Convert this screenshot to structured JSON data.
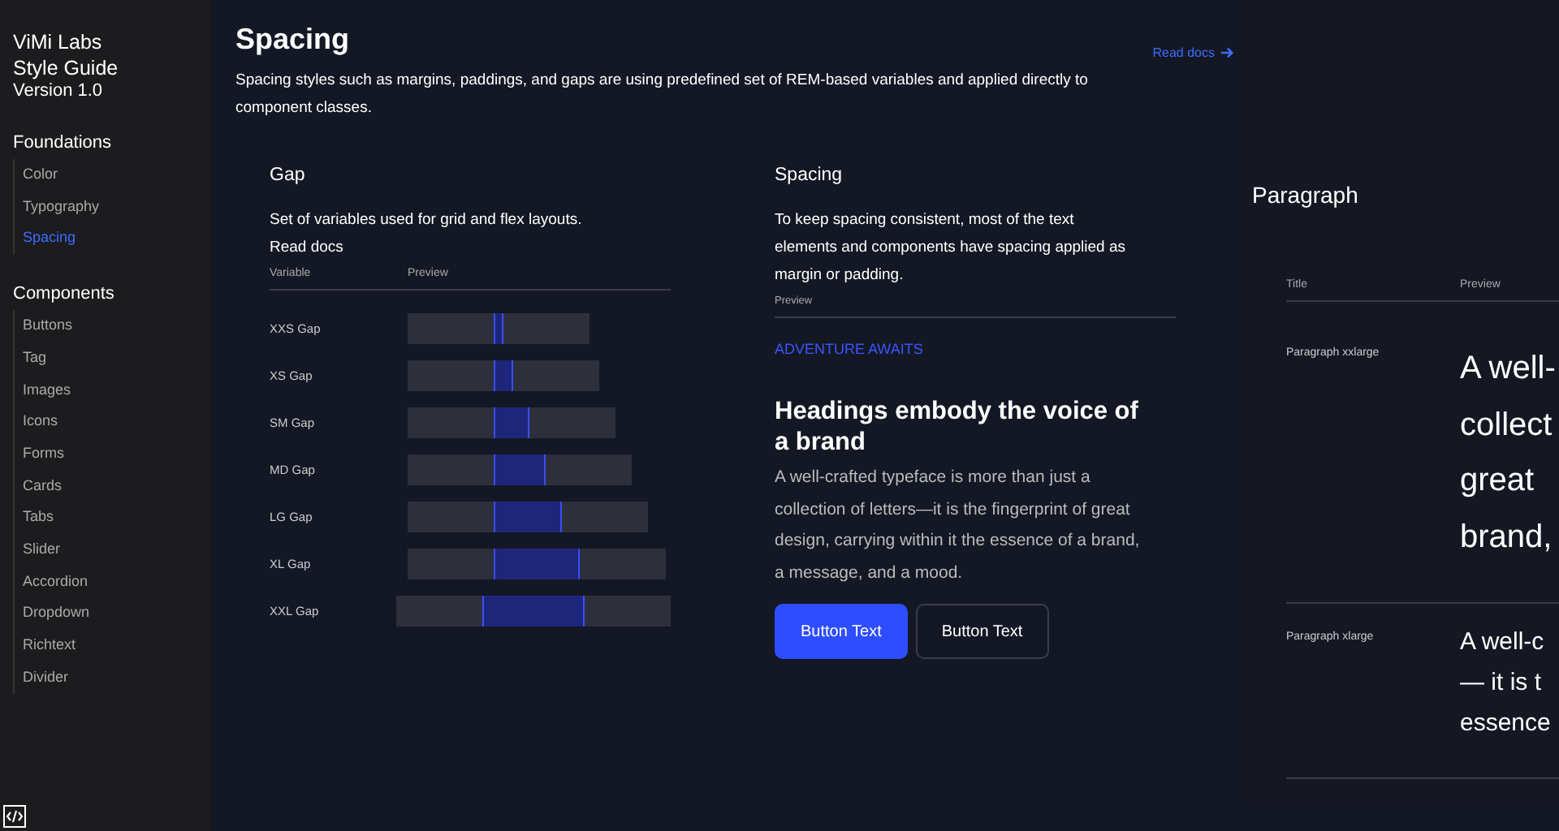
{
  "sidebar": {
    "brand": [
      "ViMi Labs",
      "Style Guide"
    ],
    "version": "Version 1.0",
    "groups": [
      {
        "title": "Foundations",
        "items": [
          {
            "label": "Color",
            "selected": false
          },
          {
            "label": "Typography",
            "selected": false
          },
          {
            "label": "Spacing",
            "selected": true
          }
        ]
      },
      {
        "title": "Components",
        "items": [
          {
            "label": "Buttons",
            "selected": false
          },
          {
            "label": "Tag",
            "selected": false
          },
          {
            "label": "Images",
            "selected": false
          },
          {
            "label": "Icons",
            "selected": false
          },
          {
            "label": "Forms",
            "selected": false
          },
          {
            "label": "Cards",
            "selected": false
          },
          {
            "label": "Tabs",
            "selected": false
          },
          {
            "label": "Slider",
            "selected": false
          },
          {
            "label": "Accordion",
            "selected": false
          },
          {
            "label": "Dropdown",
            "selected": false
          },
          {
            "label": "Richtext",
            "selected": false
          },
          {
            "label": "Divider",
            "selected": false
          }
        ]
      }
    ]
  },
  "header": {
    "title": "Spacing",
    "description": "Spacing styles such as margins, paddings, and gaps are using predefined set of REM-based variables and applied directly to component classes.",
    "link": "Read docs"
  },
  "gap": {
    "title": "Gap",
    "description": "Set of variables used for grid and flex layouts.",
    "link": "Read docs",
    "columns": [
      "Variable",
      "Preview"
    ],
    "rows": [
      "XXS Gap",
      "XS Gap",
      "SM Gap",
      "MD Gap",
      "LG Gap",
      "XL Gap",
      "XXL Gap"
    ]
  },
  "spacing": {
    "title": "Spacing",
    "description": "To keep spacing consistent, most of the text elements and components have spacing applied as margin or padding.",
    "preview_label": "Preview",
    "eyebrow": "ADVENTURE AWAITS",
    "heading": "Headings embody the voice of a brand",
    "body": "A well-crafted typeface is more than just a collection of letters—it is the fingerprint of great design, carrying within it the essence of a brand, a message, and a mood.",
    "buttons": [
      {
        "label": "Button Text",
        "kind": "primary"
      },
      {
        "label": "Button Text",
        "kind": "outline"
      }
    ]
  },
  "paragraph": {
    "title": "Paragraph",
    "columns": [
      "Title",
      "Preview"
    ],
    "rows": [
      {
        "title": "Paragraph xxlarge",
        "kind": "xxlarge",
        "lines": [
          "A well-",
          "collect",
          "great",
          "brand,"
        ]
      },
      {
        "title": "Paragraph xlarge",
        "kind": "xlarge",
        "lines": [
          "A well-c",
          "— it is t",
          "essence"
        ]
      }
    ]
  }
}
